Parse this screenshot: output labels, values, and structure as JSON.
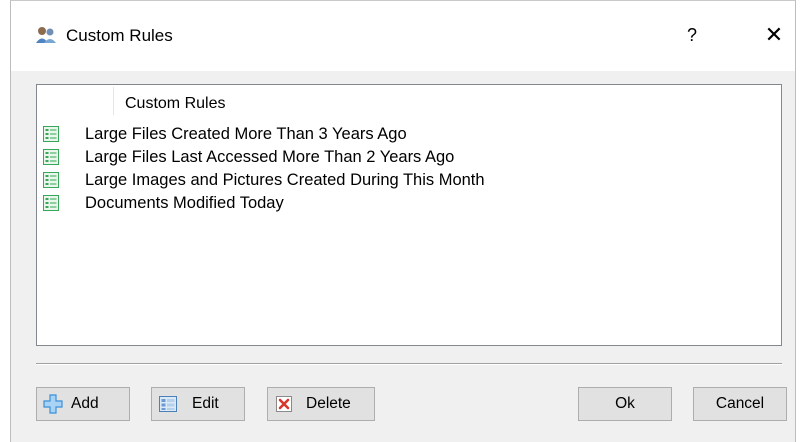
{
  "window": {
    "title": "Custom Rules",
    "help_label": "?",
    "close_label": "✕",
    "icon": "custom-rules-app-icon"
  },
  "list": {
    "column_header": "Custom Rules",
    "items": [
      {
        "label": "Large Files Created More Than 3 Years Ago",
        "icon": "rule-icon"
      },
      {
        "label": "Large Files Last Accessed More Than 2 Years Ago",
        "icon": "rule-icon"
      },
      {
        "label": "Large Images and Pictures Created During This Month",
        "icon": "rule-icon"
      },
      {
        "label": "Documents Modified Today",
        "icon": "rule-icon"
      }
    ]
  },
  "buttons": {
    "add": "Add",
    "edit": "Edit",
    "delete": "Delete",
    "ok": "Ok",
    "cancel": "Cancel"
  },
  "colors": {
    "window_bg": "#f0f0f0",
    "titlebar_bg": "#ffffff",
    "list_border": "#828790",
    "button_bg": "#e1e1e1",
    "button_border": "#adadad",
    "add_icon": "#3b8fd9",
    "delete_icon": "#d9362b",
    "rule_icon": "#3aa65a"
  }
}
